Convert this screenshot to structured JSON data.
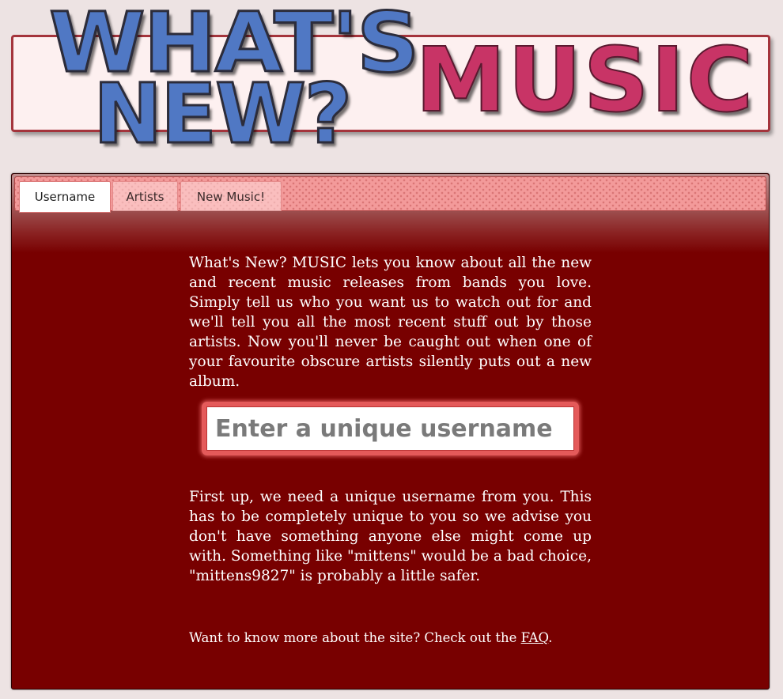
{
  "logo": {
    "line1": "WHAT'S",
    "line2": "NEW?",
    "word": "MUSIC"
  },
  "tabs": [
    {
      "label": "Username",
      "active": true
    },
    {
      "label": "Artists",
      "active": false
    },
    {
      "label": "New Music!",
      "active": false
    }
  ],
  "intro": "What's New? MUSIC lets you know about all the new and recent music releases from bands you love. Simply tell us who you want us to watch out for and we'll tell you all the most recent stuff out by those artists. Now you'll never be caught out when one of your favourite obscure artists silently puts out a new album.",
  "username_input": {
    "placeholder": "Enter a unique username",
    "value": ""
  },
  "explain": "First up, we need a unique username from you. This has to be completely unique to you so we advise you don't have something anyone else might come up with. Something like \"mittens\" would be a bad choice, \"mittens9827\" is probably a little safer.",
  "faq": {
    "prefix": "Want to know more about the site? Check out the ",
    "link": "FAQ",
    "suffix": "."
  },
  "colors": {
    "page_bg": "#ede3e3",
    "panel_bg": "#780000",
    "logo_blue": "#5078c4",
    "logo_pink": "#c83466",
    "tabbar_bg": "#f39a9a"
  }
}
